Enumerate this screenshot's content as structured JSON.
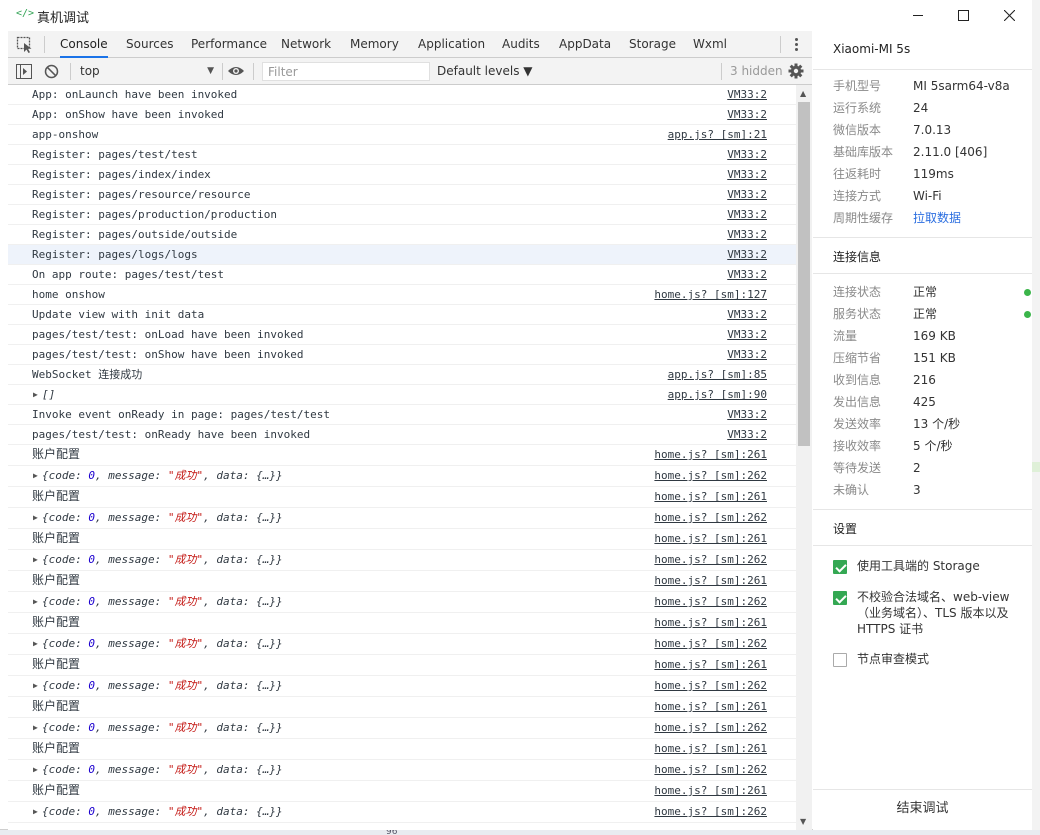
{
  "window": {
    "title": "真机调试",
    "logo": "</>",
    "minimize_icon": "minimize-icon",
    "maximize_icon": "maximize-icon",
    "close_icon": "close-icon"
  },
  "tabs": [
    "Console",
    "Sources",
    "Performance",
    "Network",
    "Memory",
    "Application",
    "Audits",
    "AppData",
    "Storage",
    "Wxml"
  ],
  "active_tab": "Console",
  "toolbar": {
    "context": "top",
    "filter_placeholder": "Filter",
    "levels": "Default levels ▼",
    "hidden": "3 hidden"
  },
  "console": {
    "rows": [
      {
        "type": "log",
        "text": "App: onLaunch have been invoked",
        "src": "VM33:2"
      },
      {
        "type": "log",
        "text": "App: onShow have been invoked",
        "src": "VM33:2"
      },
      {
        "type": "log",
        "text": "app-onshow",
        "src": "app.js? [sm]:21"
      },
      {
        "type": "log",
        "text": "Register: pages/test/test",
        "src": "VM33:2"
      },
      {
        "type": "log",
        "text": "Register: pages/index/index",
        "src": "VM33:2"
      },
      {
        "type": "log",
        "text": "Register: pages/resource/resource",
        "src": "VM33:2"
      },
      {
        "type": "log",
        "text": "Register: pages/production/production",
        "src": "VM33:2"
      },
      {
        "type": "log",
        "text": "Register: pages/outside/outside",
        "src": "VM33:2"
      },
      {
        "type": "log",
        "text": "Register: pages/logs/logs",
        "src": "VM33:2",
        "selected": true
      },
      {
        "type": "log",
        "text": "On app route: pages/test/test",
        "src": "VM33:2"
      },
      {
        "type": "log",
        "text": "home onshow",
        "src": "home.js? [sm]:127"
      },
      {
        "type": "log",
        "text": "Update view with init data",
        "src": "VM33:2"
      },
      {
        "type": "log",
        "text": "pages/test/test: onLoad have been invoked",
        "src": "VM33:2"
      },
      {
        "type": "log",
        "text": "pages/test/test: onShow have been invoked",
        "src": "VM33:2"
      },
      {
        "type": "log",
        "text": "WebSocket 连接成功",
        "src": "app.js? [sm]:85"
      },
      {
        "type": "arr",
        "text": "[]",
        "src": "app.js? [sm]:90"
      },
      {
        "type": "log",
        "text": "Invoke event onReady in page: pages/test/test",
        "src": "VM33:2"
      },
      {
        "type": "log",
        "text": "pages/test/test: onReady have been invoked",
        "src": "VM33:2"
      },
      {
        "type": "cn",
        "text": "账户配置",
        "src": "home.js? [sm]:261"
      },
      {
        "type": "obj",
        "code": "0",
        "message": "\"成功\"",
        "data": "{…}",
        "src": "home.js? [sm]:262"
      },
      {
        "type": "cn",
        "text": "账户配置",
        "src": "home.js? [sm]:261"
      },
      {
        "type": "obj",
        "code": "0",
        "message": "\"成功\"",
        "data": "{…}",
        "src": "home.js? [sm]:262"
      },
      {
        "type": "cn",
        "text": "账户配置",
        "src": "home.js? [sm]:261"
      },
      {
        "type": "obj",
        "code": "0",
        "message": "\"成功\"",
        "data": "{…}",
        "src": "home.js? [sm]:262"
      },
      {
        "type": "cn",
        "text": "账户配置",
        "src": "home.js? [sm]:261"
      },
      {
        "type": "obj",
        "code": "0",
        "message": "\"成功\"",
        "data": "{…}",
        "src": "home.js? [sm]:262"
      },
      {
        "type": "cn",
        "text": "账户配置",
        "src": "home.js? [sm]:261"
      },
      {
        "type": "obj",
        "code": "0",
        "message": "\"成功\"",
        "data": "{…}",
        "src": "home.js? [sm]:262"
      },
      {
        "type": "cn",
        "text": "账户配置",
        "src": "home.js? [sm]:261"
      },
      {
        "type": "obj",
        "code": "0",
        "message": "\"成功\"",
        "data": "{…}",
        "src": "home.js? [sm]:262"
      },
      {
        "type": "cn",
        "text": "账户配置",
        "src": "home.js? [sm]:261"
      },
      {
        "type": "obj",
        "code": "0",
        "message": "\"成功\"",
        "data": "{…}",
        "src": "home.js? [sm]:262"
      },
      {
        "type": "cn",
        "text": "账户配置",
        "src": "home.js? [sm]:261"
      },
      {
        "type": "obj",
        "code": "0",
        "message": "\"成功\"",
        "data": "{…}",
        "src": "home.js? [sm]:262"
      },
      {
        "type": "cn",
        "text": "账户配置",
        "src": "home.js? [sm]:261"
      },
      {
        "type": "obj",
        "code": "0",
        "message": "\"成功\"",
        "data": "{…}",
        "src": "home.js? [sm]:262"
      }
    ]
  },
  "panel": {
    "device_name": "Xiaomi-MI 5s",
    "device_info": [
      {
        "label": "手机型号",
        "value": "MI 5sarm64-v8a"
      },
      {
        "label": "运行系统",
        "value": "24"
      },
      {
        "label": "微信版本",
        "value": "7.0.13"
      },
      {
        "label": "基础库版本",
        "value": "2.11.0 [406]"
      },
      {
        "label": "往返耗时",
        "value": "119ms"
      },
      {
        "label": "连接方式",
        "value": "Wi-Fi"
      },
      {
        "label": "周期性缓存",
        "value": "拉取数据",
        "link": true
      }
    ],
    "connection_title": "连接信息",
    "connection_info": [
      {
        "label": "连接状态",
        "value": "正常",
        "dot": true
      },
      {
        "label": "服务状态",
        "value": "正常",
        "dot": true
      },
      {
        "label": "流量",
        "value": "169 KB"
      },
      {
        "label": "压缩节省",
        "value": "151 KB"
      },
      {
        "label": "收到信息",
        "value": "216"
      },
      {
        "label": "发出信息",
        "value": "425"
      },
      {
        "label": "发送效率",
        "value": "13 个/秒"
      },
      {
        "label": "接收效率",
        "value": "5 个/秒"
      },
      {
        "label": "等待发送",
        "value": "2"
      },
      {
        "label": "未确认",
        "value": "3"
      }
    ],
    "status_color": "#3bb54a",
    "settings_title": "设置",
    "settings": [
      {
        "label": "使用工具端的 Storage",
        "checked": true
      },
      {
        "label": "不校验合法域名、web-view（业务域名）、TLS 版本以及 HTTPS 证书",
        "checked": true
      },
      {
        "label": "节点审查模式",
        "checked": false
      }
    ],
    "end_button": "结束调试"
  },
  "background_fragment": "96"
}
